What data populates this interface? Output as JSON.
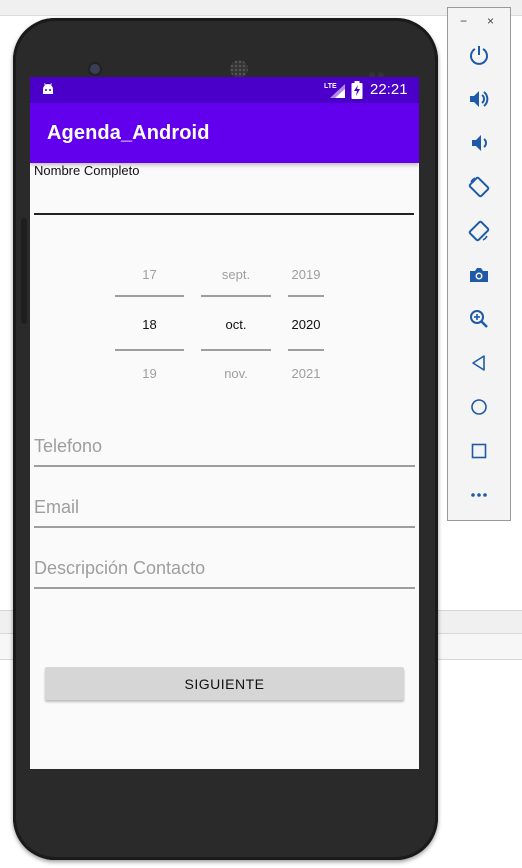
{
  "status_bar": {
    "time": "22:21",
    "network": "LTE"
  },
  "app_bar": {
    "title": "Agenda_Android"
  },
  "form": {
    "name_label": "Nombre Completo",
    "name_value": "",
    "date_picker": {
      "day": {
        "prev": "17",
        "selected": "18",
        "next": "19"
      },
      "month": {
        "prev": "sept.",
        "selected": "oct.",
        "next": "nov."
      },
      "year": {
        "prev": "2019",
        "selected": "2020",
        "next": "2021"
      }
    },
    "phone_placeholder": "Telefono",
    "email_placeholder": "Email",
    "description_placeholder": "Descripción Contacto",
    "next_button": "SIGUIENTE"
  },
  "emulator_toolbar": {
    "minimize_label": "−",
    "close_label": "×",
    "buttons": [
      "power-icon",
      "volume-up-icon",
      "volume-down-icon",
      "rotate-left-icon",
      "rotate-right-icon",
      "camera-icon",
      "zoom-icon",
      "back-icon",
      "home-icon",
      "overview-icon",
      "more-icon"
    ]
  },
  "colors": {
    "status_bar": "#4a00c9",
    "app_bar": "#6200ee",
    "toolbar_icon": "#1e5aa8"
  }
}
